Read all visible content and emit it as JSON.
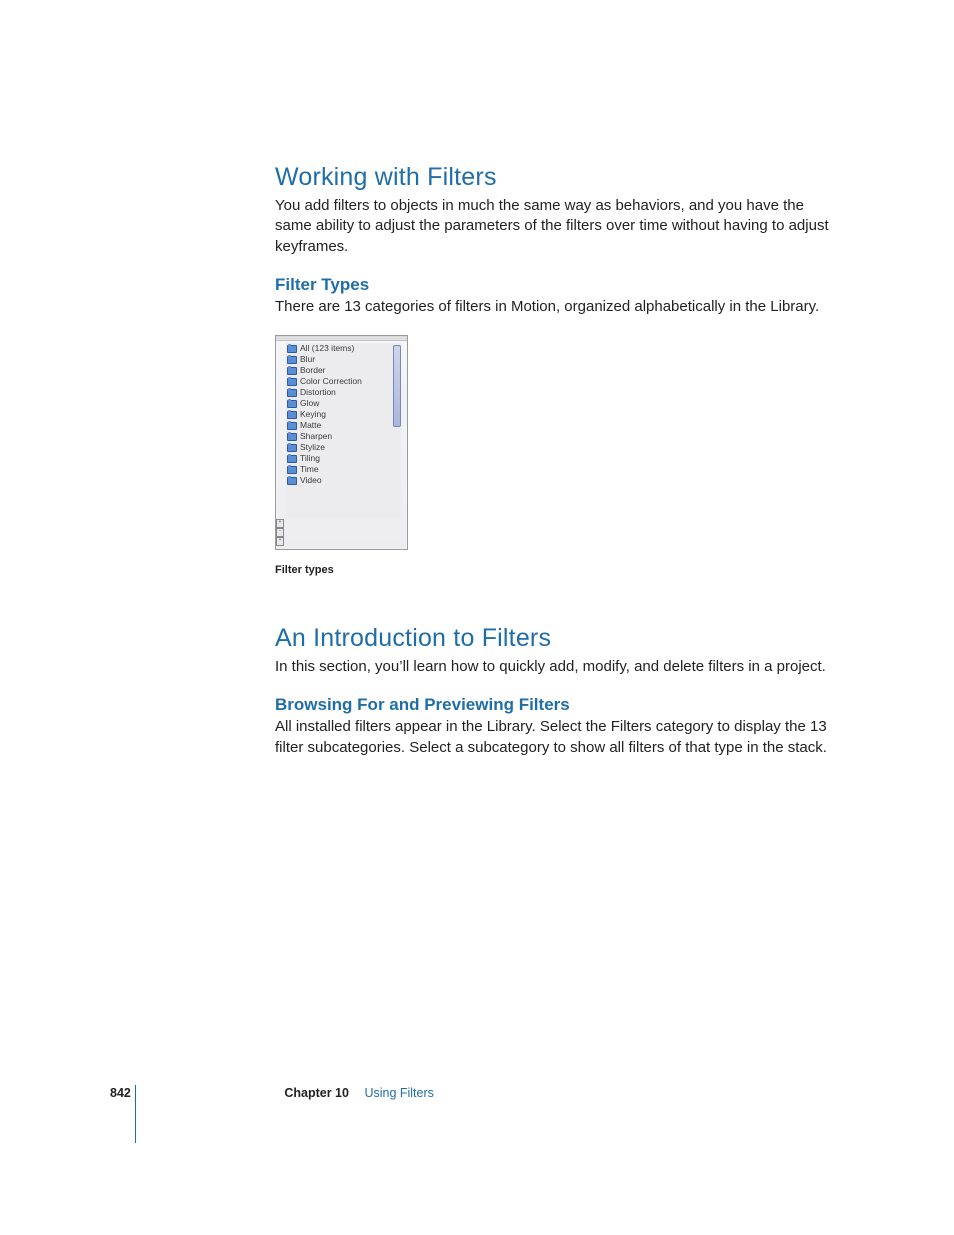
{
  "heading1": "Working with Filters",
  "para1": "You add filters to objects in much the same way as behaviors, and you have the same ability to adjust the parameters of the filters over time without having to adjust keyframes.",
  "sub1": "Filter Types",
  "para2": "There are 13 categories of filters in Motion, organized alphabetically in the Library.",
  "library": {
    "items": [
      "All (123 items)",
      "Blur",
      "Border",
      "Color Correction",
      "Distortion",
      "Glow",
      "Keying",
      "Matte",
      "Sharpen",
      "Stylize",
      "Tiling",
      "Time",
      "Video"
    ]
  },
  "caption1": "Filter types",
  "heading2": "An Introduction to Filters",
  "para3": "In this section, you’ll learn how to quickly add, modify, and delete filters in a project.",
  "sub2": "Browsing For and Previewing Filters",
  "para4": "All installed filters appear in the Library. Select the Filters category to display the 13 filter subcategories. Select a subcategory to show all filters of that type in the stack.",
  "footer": {
    "page": "842",
    "chapter_label": "Chapter 10",
    "chapter_title": "Using Filters"
  }
}
